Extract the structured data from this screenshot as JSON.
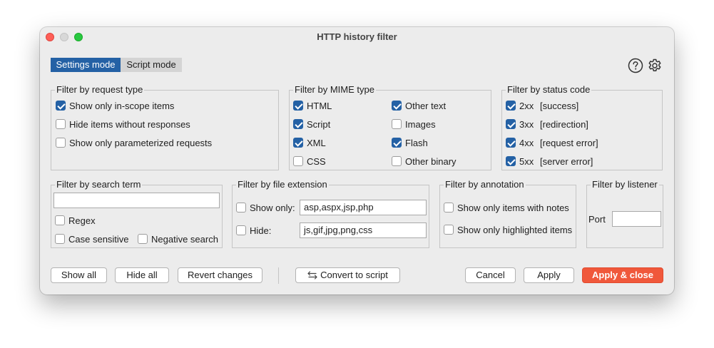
{
  "window": {
    "title": "HTTP history filter"
  },
  "modes": {
    "settings": "Settings mode",
    "script": "Script mode"
  },
  "icons": {
    "help": "help-icon",
    "settings": "gear-icon",
    "convert": "swap-arrows-icon"
  },
  "colors": {
    "accent": "#2461a5",
    "apply_close": "#f0583b"
  },
  "request_type": {
    "title": "Filter by request type",
    "items": [
      {
        "label": "Show only in-scope items",
        "checked": true
      },
      {
        "label": "Hide items without responses",
        "checked": false
      },
      {
        "label": "Show only parameterized requests",
        "checked": false
      }
    ]
  },
  "mime_type": {
    "title": "Filter by MIME type",
    "items": [
      {
        "label": "HTML",
        "checked": true
      },
      {
        "label": "Script",
        "checked": true
      },
      {
        "label": "XML",
        "checked": true
      },
      {
        "label": "CSS",
        "checked": false
      },
      {
        "label": "Other text",
        "checked": true
      },
      {
        "label": "Images",
        "checked": false
      },
      {
        "label": "Flash",
        "checked": true
      },
      {
        "label": "Other binary",
        "checked": false
      }
    ]
  },
  "status_code": {
    "title": "Filter by status code",
    "items": [
      {
        "code": "2xx",
        "label": "[success]",
        "checked": true
      },
      {
        "code": "3xx",
        "label": "[redirection]",
        "checked": true
      },
      {
        "code": "4xx",
        "label": "[request error]",
        "checked": true
      },
      {
        "code": "5xx",
        "label": "[server error]",
        "checked": true
      }
    ]
  },
  "search_term": {
    "title": "Filter by search term",
    "value": "",
    "regex": {
      "label": "Regex",
      "checked": false
    },
    "case_sensitive": {
      "label": "Case sensitive",
      "checked": false
    },
    "negative": {
      "label": "Negative search",
      "checked": false
    }
  },
  "file_extension": {
    "title": "Filter by file extension",
    "show_only": {
      "label": "Show only:",
      "checked": false,
      "value": "asp,aspx,jsp,php"
    },
    "hide": {
      "label": "Hide:",
      "checked": false,
      "value": "js,gif,jpg,png,css"
    }
  },
  "annotation": {
    "title": "Filter by annotation",
    "items": [
      {
        "label": "Show only items with notes",
        "checked": false
      },
      {
        "label": "Show only highlighted items",
        "checked": false
      }
    ]
  },
  "listener": {
    "title": "Filter by listener",
    "port_label": "Port",
    "port_value": ""
  },
  "buttons": {
    "show_all": "Show all",
    "hide_all": "Hide all",
    "revert": "Revert changes",
    "convert": "Convert to script",
    "cancel": "Cancel",
    "apply": "Apply",
    "apply_close": "Apply & close"
  }
}
